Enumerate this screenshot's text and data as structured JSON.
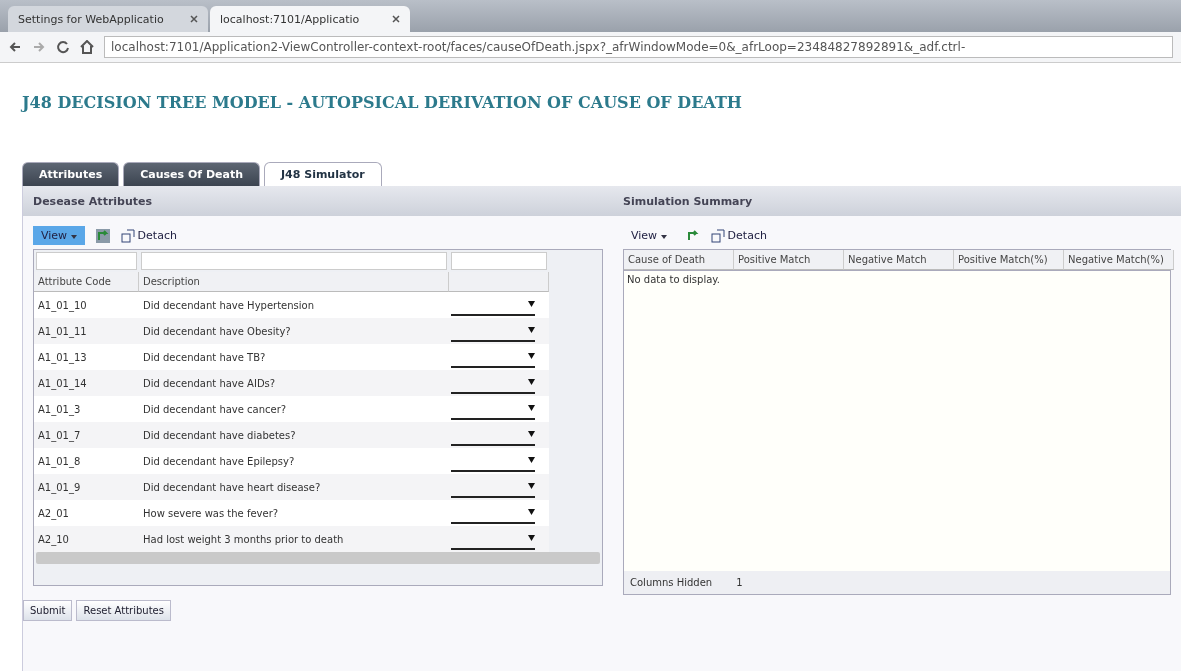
{
  "browser": {
    "tabs": [
      {
        "title": "Settings for WebApplicatio",
        "selected": false
      },
      {
        "title": "localhost:7101/Applicatio",
        "selected": true
      }
    ],
    "url": "localhost:7101/Application2-ViewController-context-root/faces/causeOfDeath.jspx?_afrWindowMode=0&_afrLoop=23484827892891&_adf.ctrl-"
  },
  "page_title": "J48 DECISION TREE MODEL - AUTOPSICAL DERIVATION OF CAUSE OF DEATH",
  "tabs": [
    {
      "label": "Attributes",
      "selected": false
    },
    {
      "label": "Causes Of Death",
      "selected": false
    },
    {
      "label": "J48 Simulator",
      "selected": true
    }
  ],
  "left_panel": {
    "title": "Desease Attributes",
    "toolbar": {
      "view": "View",
      "detach": "Detach"
    },
    "columns": [
      "Attribute Code",
      "Description"
    ],
    "rows": [
      {
        "code": "A1_01_10",
        "description": "Did decendant have Hypertension"
      },
      {
        "code": "A1_01_11",
        "description": "Did decendant have Obesity?"
      },
      {
        "code": "A1_01_13",
        "description": "Did decendant have TB?"
      },
      {
        "code": "A1_01_14",
        "description": "Did decendant have AIDs?"
      },
      {
        "code": "A1_01_3",
        "description": "Did decendant have cancer?"
      },
      {
        "code": "A1_01_7",
        "description": "Did decendant have diabetes?"
      },
      {
        "code": "A1_01_8",
        "description": "Did decendant have Epilepsy?"
      },
      {
        "code": "A1_01_9",
        "description": "Did decendant have heart disease?"
      },
      {
        "code": "A2_01",
        "description": "How severe was the fever?"
      },
      {
        "code": "A2_10",
        "description": "Had lost weight 3 months prior to death"
      }
    ]
  },
  "right_panel": {
    "title": "Simulation Summary",
    "toolbar": {
      "view": "View",
      "detach": "Detach"
    },
    "columns": [
      "Cause of Death",
      "Positive Match",
      "Negative Match",
      "Positive Match(%)",
      "Negative Match(%)"
    ],
    "empty_text": "No data to display.",
    "status_label": "Columns Hidden",
    "status_value": "1"
  },
  "buttons": [
    "Submit",
    "Reset Attributes"
  ]
}
